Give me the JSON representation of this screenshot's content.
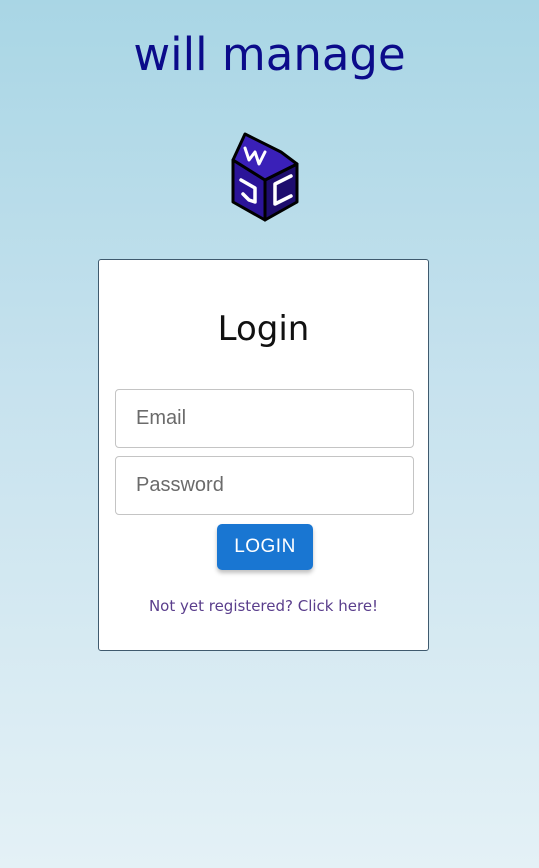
{
  "app": {
    "title": "will manage",
    "title_color": "#0b0b8a"
  },
  "logo": {
    "icon": "wjc-house-logo-icon",
    "fill": "#2b1499",
    "outline": "#000000"
  },
  "login_card": {
    "title": "Login",
    "email": {
      "placeholder": "Email",
      "value": ""
    },
    "password": {
      "placeholder": "Password",
      "value": ""
    },
    "login_button_label": "LOGIN",
    "register_link_text": "Not yet registered? Click here!"
  },
  "colors": {
    "accent": "#1976d2",
    "link": "#5a3e8c"
  }
}
